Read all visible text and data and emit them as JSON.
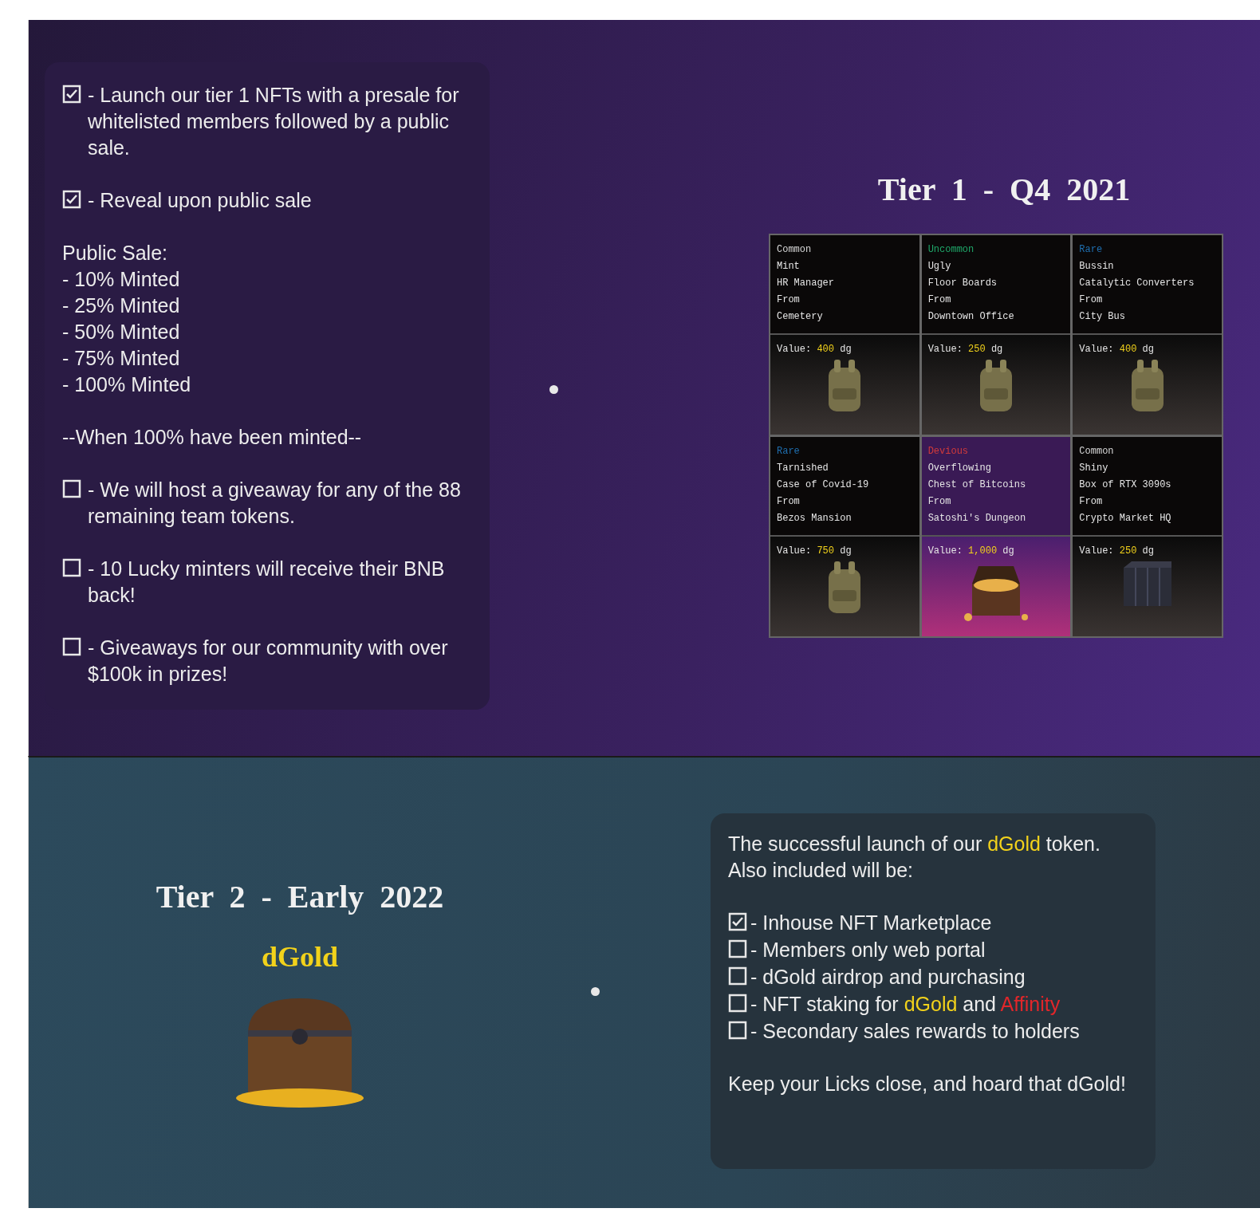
{
  "tier1": {
    "checklist": [
      {
        "checked": true,
        "text": "- Launch our tier 1 NFTs with a presale for whitelisted members followed by a public sale."
      },
      {
        "checked": true,
        "text": "-  Reveal upon public sale"
      }
    ],
    "public_sale": {
      "title": "Public Sale:",
      "items": [
        "- 10% Minted",
        "- 25% Minted",
        "- 50% Minted",
        "- 75% Minted",
        "- 100% Minted"
      ]
    },
    "note": "--When 100% have been minted--",
    "goals": [
      {
        "checked": false,
        "text": "- We will host a giveaway for any of the 88 remaining team tokens."
      },
      {
        "checked": false,
        "text": "- 10 Lucky minters will receive their BNB back!"
      },
      {
        "checked": false,
        "text": "- Giveaways for our community with over $100k in prizes!"
      }
    ],
    "title": "Tier  1  -  Q4  2021",
    "cards": [
      {
        "rarity": "Common",
        "color": "#d8d8d8",
        "lines": [
          "Mint",
          "HR Manager",
          "From",
          "Cemetery"
        ],
        "value_label": "Value:",
        "value": "400",
        "unit": "dg",
        "kind": "backpack"
      },
      {
        "rarity": "Uncommon",
        "color": "#1fa86a",
        "lines": [
          "Ugly",
          "Floor Boards",
          "From",
          "Downtown Office"
        ],
        "value_label": "Value:",
        "value": "250",
        "unit": "dg",
        "kind": "backpack"
      },
      {
        "rarity": "Rare",
        "color": "#1f6fb0",
        "lines": [
          "Bussin",
          "Catalytic Converters",
          "From",
          "City Bus"
        ],
        "value_label": "Value:",
        "value": "400",
        "unit": "dg",
        "kind": "backpack"
      },
      {
        "rarity": "Rare",
        "color": "#1f6fb0",
        "lines": [
          "Tarnished",
          "Case of Covid-19",
          "From",
          "Bezos Mansion"
        ],
        "value_label": "Value:",
        "value": "750",
        "unit": "dg",
        "kind": "backpack"
      },
      {
        "rarity": "Devious",
        "color": "#d23a3a",
        "lines": [
          "Overflowing",
          "Chest of Bitcoins",
          "From",
          "Satoshi's Dungeon"
        ],
        "value_label": "Value:",
        "value": "1,000",
        "unit": "dg",
        "kind": "chest"
      },
      {
        "rarity": "Common",
        "color": "#d8d8d8",
        "lines": [
          "Shiny",
          "Box of RTX 3090s",
          "From",
          "Crypto Market HQ"
        ],
        "value_label": "Value:",
        "value": "250",
        "unit": "dg",
        "kind": "crate"
      }
    ]
  },
  "tier2": {
    "title": "Tier  2  -  Early  2022",
    "subtitle": "dGold",
    "intro": [
      {
        "text": "The successful launch of our "
      },
      {
        "text": "dGold",
        "kind": "gold"
      },
      {
        "text": " token. Also included will be:"
      }
    ],
    "checklist": [
      {
        "checked": true,
        "parts": [
          {
            "text": "- Inhouse NFT Marketplace"
          }
        ]
      },
      {
        "checked": false,
        "parts": [
          {
            "text": "- Members only web portal"
          }
        ]
      },
      {
        "checked": false,
        "parts": [
          {
            "text": "- dGold airdrop and purchasing"
          }
        ]
      },
      {
        "checked": false,
        "parts": [
          {
            "text": "- NFT staking for "
          },
          {
            "text": "dGold",
            "kind": "gold"
          },
          {
            "text": " and "
          },
          {
            "text": "Affinity",
            "kind": "red"
          }
        ]
      },
      {
        "checked": false,
        "parts": [
          {
            "text": "- Secondary sales rewards to holders"
          }
        ]
      }
    ],
    "closing": "Keep your Licks close, and hoard that dGold!"
  }
}
